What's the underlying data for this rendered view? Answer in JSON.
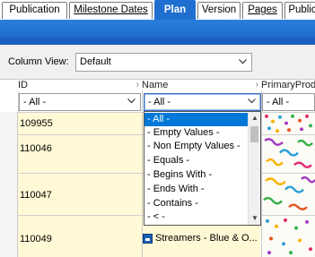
{
  "tabs": [
    {
      "label": "Publication",
      "active": false
    },
    {
      "label": "Milestone Dates",
      "active": false
    },
    {
      "label": "Plan",
      "active": true
    },
    {
      "label": "Version",
      "active": false
    },
    {
      "label": "Pages",
      "active": false
    },
    {
      "label": "Public",
      "active": false
    }
  ],
  "column_view": {
    "label": "Column View:",
    "value": "Default"
  },
  "grid": {
    "headers": {
      "id": "ID",
      "name": "Name",
      "primary": "PrimaryProd"
    },
    "filters": {
      "id": "- All -",
      "name": "- All -",
      "primary": "- All -"
    },
    "rows": [
      {
        "id": "109955",
        "name": ""
      },
      {
        "id": "110046",
        "name": ""
      },
      {
        "id": "110047",
        "name": ""
      },
      {
        "id": "110049",
        "name": "Streamers - Blue & O..."
      }
    ]
  },
  "dropdown": {
    "options": [
      "- All -",
      "- Empty Values -",
      "- Non Empty Values -",
      "- Equals -",
      "- Begins With -",
      "- Ends With -",
      "- Contains -",
      "- < -"
    ],
    "selected_index": 0
  },
  "colors": {
    "accent": "#1f6fd0",
    "highlight": "#0078d7",
    "row_bg": "#fff9d6"
  }
}
